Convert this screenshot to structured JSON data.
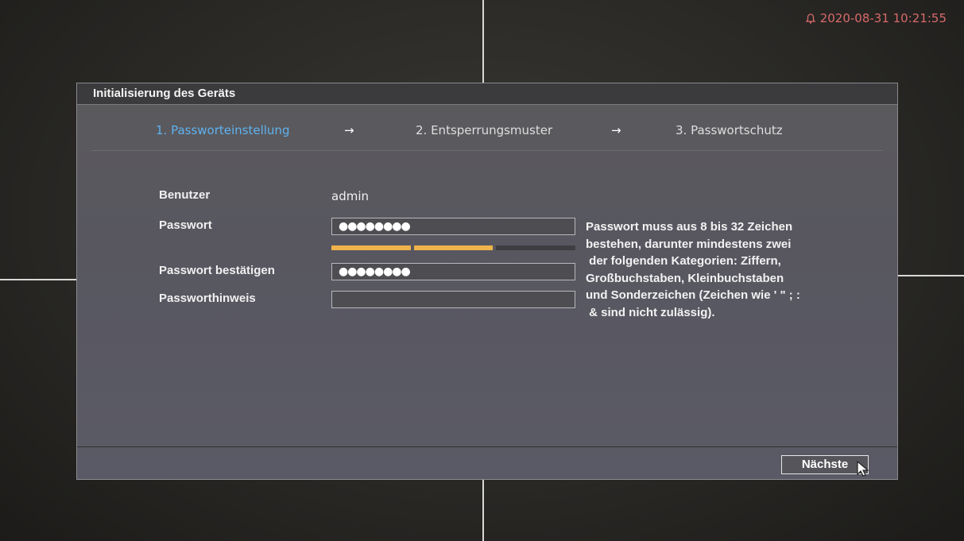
{
  "clock": {
    "datetime": "2020-08-31 10:21:55",
    "icon": "bell-icon",
    "color": "#d86a6a"
  },
  "dialog": {
    "title": "Initialisierung des Geräts",
    "steps": [
      {
        "label": "1.  Passworteinstellung",
        "active": true
      },
      {
        "label": "2.  Entsperrungsmuster",
        "active": false
      },
      {
        "label": "3.  Passwortschutz",
        "active": false
      }
    ],
    "arrow": "→",
    "form": {
      "user_label": "Benutzer",
      "user_value": "admin",
      "password_label": "Passwort",
      "password_value": "●●●●●●●●",
      "confirm_label": "Passwort bestätigen",
      "confirm_value": "●●●●●●●●",
      "hint_label": "Passworthinweis",
      "hint_value": "",
      "strength": {
        "level": 2,
        "max": 3,
        "colors": [
          "#f0b24a",
          "#f0b24a",
          "#3e3e42"
        ]
      }
    },
    "requirements_text": "Passwort muss aus 8 bis 32 Zeichen\nbestehen, darunter mindestens zwei\n der folgenden Kategorien: Ziffern,\nGroßbuchstaben, Kleinbuchstaben\nund Sonderzeichen (Zeichen wie ' \" ; :\n & sind nicht zulässig).",
    "next_label": "Nächste"
  },
  "accent_color": "#5eb2f0"
}
